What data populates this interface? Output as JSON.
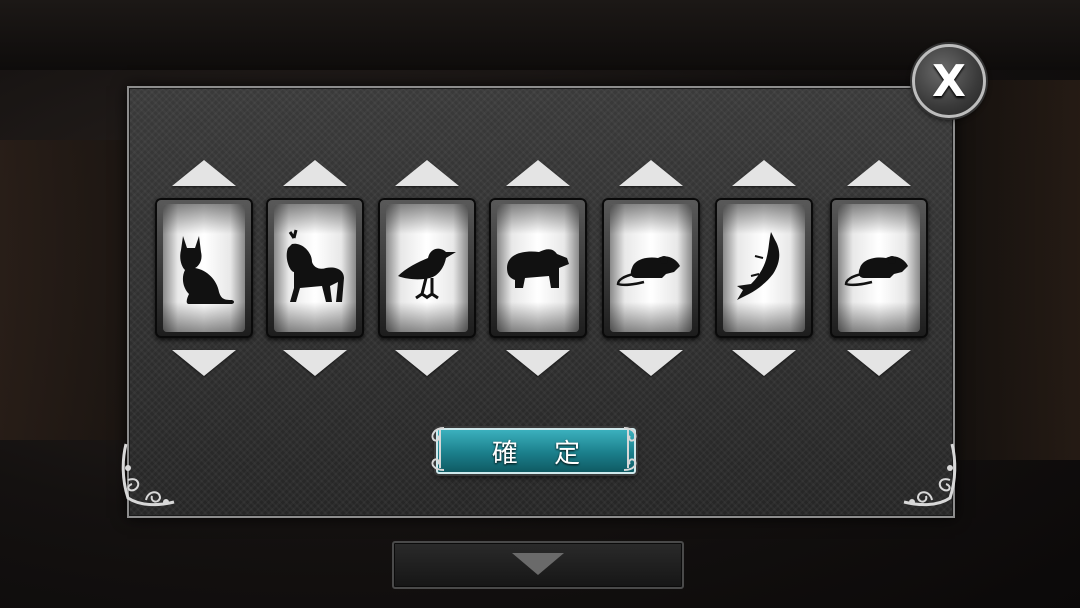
{
  "close_button": {
    "label": "X",
    "icon": "close-icon"
  },
  "reels": [
    {
      "animal": "cat",
      "icon": "cat-icon"
    },
    {
      "animal": "dog",
      "icon": "dog-icon"
    },
    {
      "animal": "bird",
      "icon": "bird-icon"
    },
    {
      "animal": "bear",
      "icon": "bear-icon"
    },
    {
      "animal": "rat",
      "icon": "rat-icon"
    },
    {
      "animal": "fish",
      "icon": "fish-icon"
    },
    {
      "animal": "rat",
      "icon": "rat-icon"
    }
  ],
  "confirm_button": {
    "label": "確 定"
  },
  "bottom_tab": {
    "icon": "chevron-down-icon"
  },
  "colors": {
    "confirm_teal": "#1b7f8b",
    "panel_gray": "#333333",
    "arrow_white": "#e4e4e4"
  }
}
